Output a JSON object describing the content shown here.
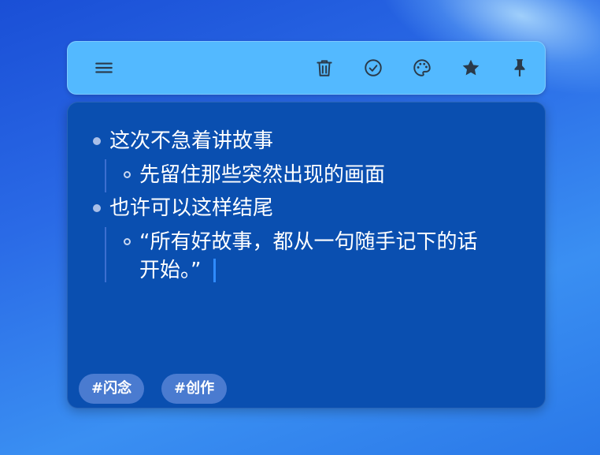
{
  "toolbar": {
    "menu_icon": "hamburger-menu-icon",
    "delete_icon": "trash-icon",
    "check_icon": "check-circle-icon",
    "color_icon": "palette-icon",
    "favorite_icon": "star-icon",
    "pin_icon": "pin-icon"
  },
  "note": {
    "items": [
      {
        "level": 1,
        "text": "这次不急着讲故事"
      },
      {
        "level": 2,
        "text": "先留住那些突然出现的画面"
      },
      {
        "level": 1,
        "text": "也许可以这样结尾"
      },
      {
        "level": 2,
        "text": "“所有好故事，都从一句随手记下的话",
        "continuation": "开始。”"
      }
    ],
    "tags": [
      "#闪念",
      "#创作"
    ]
  },
  "colors": {
    "toolbar_bg": "#53b9ff",
    "note_bg": "#0a4fb0",
    "tag_bg": "#4a7bd0",
    "caret": "#2f8bff"
  }
}
